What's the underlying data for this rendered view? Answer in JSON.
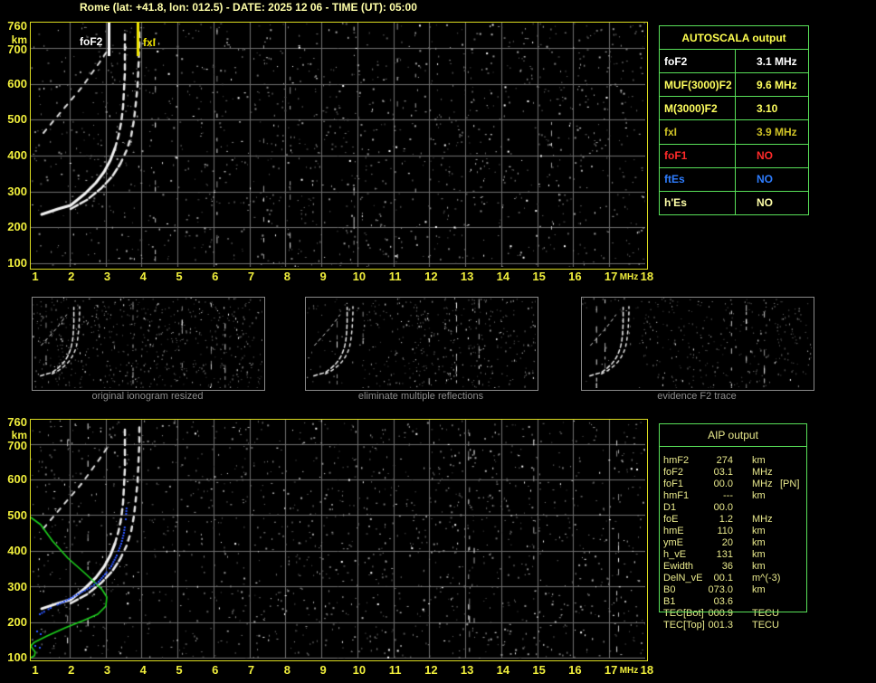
{
  "title": "Rome (lat: +41.8, lon: 012.5) - DATE: 2025 12 06 - TIME (UT): 05:00",
  "axes": {
    "x_ticks": [
      "1",
      "2",
      "3",
      "4",
      "5",
      "6",
      "7",
      "8",
      "9",
      "10",
      "11",
      "12",
      "13",
      "14",
      "15",
      "16",
      "17",
      "18"
    ],
    "x_unit": "MHz",
    "y_ticks": [
      "760",
      "km",
      "700",
      "600",
      "500",
      "400",
      "300",
      "200",
      "100"
    ],
    "x_range_mhz": [
      1,
      18
    ],
    "y_range_km": [
      100,
      760
    ]
  },
  "top_ionogram": {
    "markers": [
      {
        "label": "foF2",
        "freq_mhz": 3.1,
        "color": "#ffffff"
      },
      {
        "label": "fxI",
        "freq_mhz": 3.9,
        "color": "#f0e400"
      }
    ]
  },
  "autoscala": {
    "title": "AUTOSCALA output",
    "rows": [
      {
        "label": "foF2",
        "value": "3.1 MHz",
        "color": "#ffffff"
      },
      {
        "label": "MUF(3000)F2",
        "value": "9.6 MHz",
        "color": "#ffff5e"
      },
      {
        "label": "M(3000)F2",
        "value": "3.10",
        "color": "#ffff5e"
      },
      {
        "label": "fxI",
        "value": "3.9 MHz",
        "color": "#cfc226"
      },
      {
        "label": "foF1",
        "value": "NO",
        "color": "#ff2a2a"
      },
      {
        "label": "ftEs",
        "value": "NO",
        "color": "#2e7dff"
      },
      {
        "label": "h'Es",
        "value": "NO",
        "color": "#ffffa8"
      }
    ]
  },
  "thumbnails": [
    {
      "caption": "original ionogram resized"
    },
    {
      "caption": "eliminate multiple reflections"
    },
    {
      "caption": "evidence F2 trace"
    }
  ],
  "aip": {
    "title": "AIP output",
    "rows": [
      {
        "name": "hmF2",
        "value": "274",
        "unit": "km",
        "extra": ""
      },
      {
        "name": "foF2",
        "value": "03.1",
        "unit": "MHz",
        "extra": ""
      },
      {
        "name": "foF1",
        "value": "00.0",
        "unit": "MHz",
        "extra": "[PN]"
      },
      {
        "name": "hmF1",
        "value": "---",
        "unit": "km",
        "extra": ""
      },
      {
        "name": "D1",
        "value": "00.0",
        "unit": "",
        "extra": ""
      },
      {
        "name": "foE",
        "value": "1.2",
        "unit": "MHz",
        "extra": ""
      },
      {
        "name": "hmE",
        "value": "110",
        "unit": "km",
        "extra": ""
      },
      {
        "name": "ymE",
        "value": "20",
        "unit": "km",
        "extra": ""
      },
      {
        "name": "h_vE",
        "value": "131",
        "unit": "km",
        "extra": ""
      },
      {
        "name": "Ewidth",
        "value": "36",
        "unit": "km",
        "extra": ""
      },
      {
        "name": "DelN_vE",
        "value": "00.1",
        "unit": "m^(-3)",
        "extra": ""
      },
      {
        "name": "B0",
        "value": "073.0",
        "unit": "km",
        "extra": ""
      },
      {
        "name": "B1",
        "value": "03.6",
        "unit": "",
        "extra": ""
      },
      {
        "name": "TEC[Bot]",
        "value": "000.9",
        "unit": "TECU",
        "extra": ""
      },
      {
        "name": "TEC[Top]",
        "value": "001.3",
        "unit": "TECU",
        "extra": ""
      }
    ]
  },
  "traces": {
    "coord_space": "pixels in 679x270 plot interior, x: 1-18 MHz, y: 760-100 km",
    "o_trace": [
      [
        12,
        212
      ],
      [
        30,
        206
      ],
      [
        44,
        202
      ],
      [
        60,
        189
      ],
      [
        72,
        177
      ],
      [
        81,
        165
      ],
      [
        88,
        152
      ],
      [
        93,
        139
      ],
      [
        97,
        125
      ],
      [
        100,
        110
      ],
      [
        102,
        93
      ],
      [
        103,
        75
      ],
      [
        104,
        55
      ],
      [
        104,
        32
      ],
      [
        104,
        10
      ]
    ],
    "x_trace": [
      [
        44,
        206
      ],
      [
        62,
        196
      ],
      [
        78,
        183
      ],
      [
        90,
        170
      ],
      [
        99,
        156
      ],
      [
        106,
        141
      ],
      [
        111,
        125
      ],
      [
        114,
        108
      ],
      [
        116,
        90
      ],
      [
        118,
        70
      ],
      [
        119,
        48
      ],
      [
        120,
        26
      ],
      [
        120,
        8
      ]
    ],
    "second_hop": [
      [
        14,
        122
      ],
      [
        24,
        110
      ],
      [
        34,
        98
      ],
      [
        45,
        85
      ],
      [
        56,
        72
      ],
      [
        66,
        58
      ],
      [
        76,
        44
      ],
      [
        84,
        32
      ]
    ],
    "profile_green": [
      [
        0,
        108
      ],
      [
        11,
        116
      ],
      [
        24,
        134
      ],
      [
        41,
        153
      ],
      [
        58,
        168
      ],
      [
        70,
        179
      ],
      [
        79,
        188
      ],
      [
        84,
        196
      ],
      [
        83,
        206
      ],
      [
        74,
        215
      ],
      [
        58,
        222
      ],
      [
        38,
        230
      ],
      [
        18,
        239
      ],
      [
        4,
        246
      ],
      [
        0,
        250
      ],
      [
        2,
        253
      ],
      [
        5,
        257
      ],
      [
        4,
        261
      ],
      [
        0,
        263
      ]
    ],
    "fit_blue": [
      [
        9,
        214
      ],
      [
        21,
        207
      ],
      [
        36,
        200
      ],
      [
        51,
        192
      ],
      [
        64,
        185
      ],
      [
        74,
        178
      ],
      [
        81,
        170
      ],
      [
        88,
        161
      ],
      [
        94,
        149
      ],
      [
        99,
        136
      ],
      [
        102,
        124
      ],
      [
        104,
        109
      ],
      [
        105,
        94
      ]
    ],
    "blue_extra_dots": [
      [
        6,
        233
      ],
      [
        10,
        236
      ],
      [
        4,
        249
      ],
      [
        9,
        251
      ]
    ]
  },
  "colors": {
    "plot_border": "#dcdc20",
    "axis_text": "#f0ee3c",
    "grid": "#6f6f6f",
    "table_border": "#58e058",
    "aip_text": "#e9e98c",
    "title_text": "#ffffa8",
    "profile_green": "#1dd11d",
    "fit_blue": "#2b55ff"
  }
}
